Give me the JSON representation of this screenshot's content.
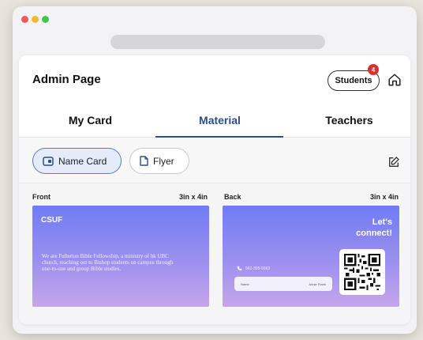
{
  "header": {
    "title": "Admin Page",
    "students_label": "Students",
    "students_badge": "4"
  },
  "tabs": [
    {
      "label": "My Card",
      "active": false
    },
    {
      "label": "Material",
      "active": true
    },
    {
      "label": "Teachers",
      "active": false
    }
  ],
  "chips": [
    {
      "label": "Name Card",
      "active": true,
      "icon": "card-icon"
    },
    {
      "label": "Flyer",
      "active": false,
      "icon": "document-icon"
    }
  ],
  "previews": {
    "front": {
      "label": "Front",
      "size": "3in x 4in",
      "org": "CSUF",
      "description": "We are Fullerton Bible Fellowship, a ministry of hk UBC church, reaching out to Bishop students on campus through one-to-one and group Bible studies."
    },
    "back": {
      "label": "Back",
      "size": "3in x 4in",
      "cta_line1": "Let's",
      "cta_line2": "connect!",
      "phone": "562-305-9363",
      "contact_name_label": "Name",
      "contact_name_value": "Annie Frank"
    }
  },
  "colors": {
    "accent": "#2f4d86",
    "badge": "#d9322b",
    "chip_active_bg": "#e3ecf8",
    "card_gradient_top": "#6f7cf4",
    "card_gradient_bottom": "#c6a6ea"
  }
}
